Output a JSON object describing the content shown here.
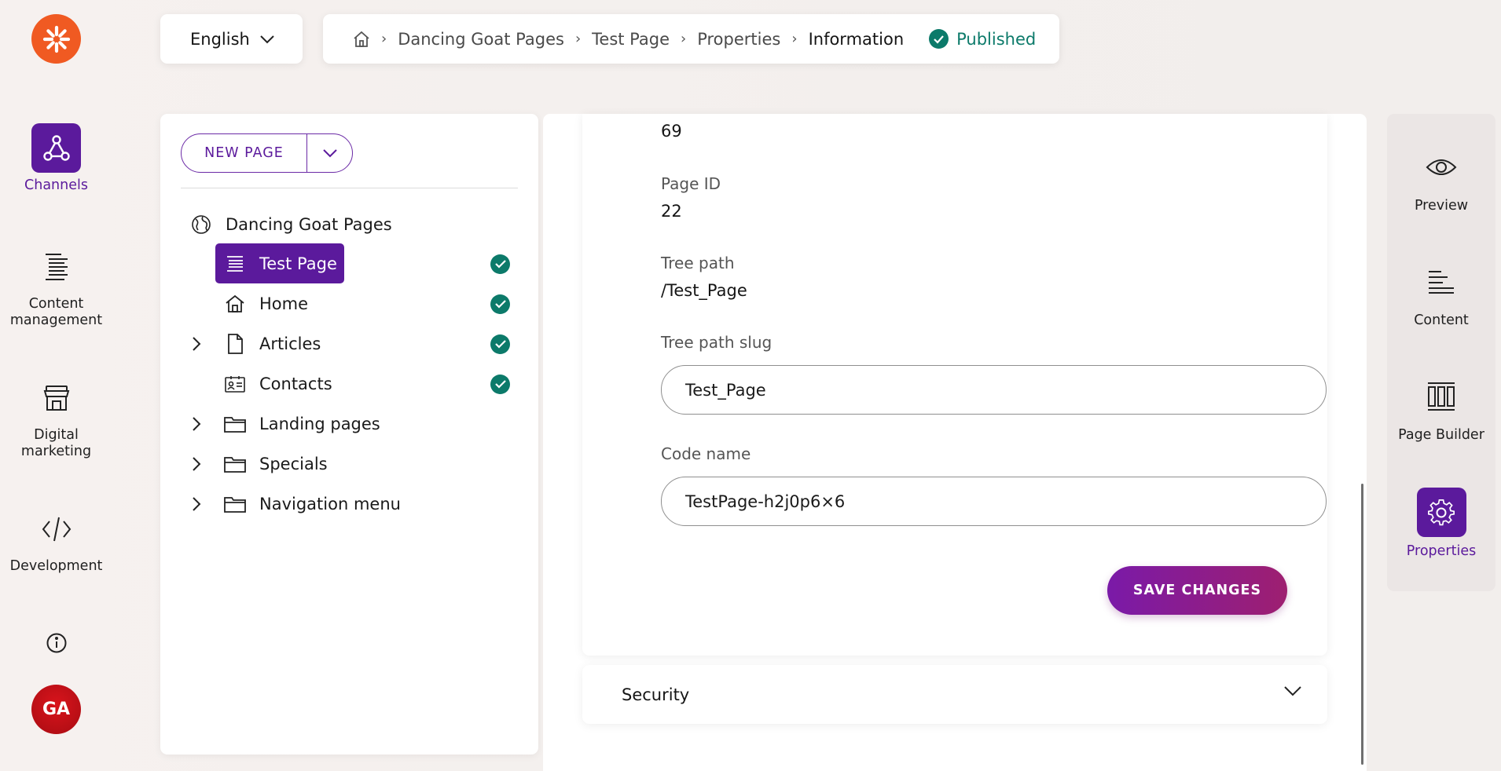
{
  "colors": {
    "brand_purple": "#5b1a9c",
    "logo_orange": "#f05a22",
    "status_green": "#0c7a6a",
    "avatar_red": "#c8101a"
  },
  "left_nav": {
    "items": [
      {
        "label": "Channels",
        "icon": "channels-icon",
        "active": true
      },
      {
        "label": "Content management",
        "icon": "content-management-icon",
        "active": false
      },
      {
        "label": "Digital marketing",
        "icon": "digital-marketing-icon",
        "active": false
      },
      {
        "label": "Development",
        "icon": "development-icon",
        "active": false
      }
    ],
    "avatar_initials": "GA"
  },
  "topbar": {
    "language": "English",
    "breadcrumb": [
      "Dancing Goat Pages",
      "Test Page",
      "Properties",
      "Information"
    ],
    "status": "Published"
  },
  "tree": {
    "new_page_label": "NEW PAGE",
    "root": "Dancing Goat Pages",
    "items": [
      {
        "label": "Test Page",
        "icon": "page-lines-icon",
        "selected": true,
        "published": true,
        "expandable": false
      },
      {
        "label": "Home",
        "icon": "home-icon",
        "selected": false,
        "published": true,
        "expandable": false
      },
      {
        "label": "Articles",
        "icon": "file-icon",
        "selected": false,
        "published": true,
        "expandable": true
      },
      {
        "label": "Contacts",
        "icon": "contact-card-icon",
        "selected": false,
        "published": true,
        "expandable": false
      },
      {
        "label": "Landing pages",
        "icon": "folder-icon",
        "selected": false,
        "published": false,
        "expandable": true
      },
      {
        "label": "Specials",
        "icon": "folder-icon",
        "selected": false,
        "published": false,
        "expandable": true
      },
      {
        "label": "Navigation menu",
        "icon": "folder-icon",
        "selected": false,
        "published": false,
        "expandable": true
      }
    ]
  },
  "main": {
    "top_value": "69",
    "page_id_label": "Page ID",
    "page_id_value": "22",
    "tree_path_label": "Tree path",
    "tree_path_value": "/Test_Page",
    "tree_path_slug_label": "Tree path slug",
    "tree_path_slug_value": "Test_Page",
    "code_name_label": "Code name",
    "code_name_value": "TestPage-h2j0p6×6",
    "save_label": "SAVE CHANGES",
    "security_label": "Security"
  },
  "right_rail": {
    "items": [
      {
        "label": "Preview",
        "icon": "eye-icon",
        "active": false
      },
      {
        "label": "Content",
        "icon": "content-lines-icon",
        "active": false
      },
      {
        "label": "Page Builder",
        "icon": "page-builder-icon",
        "active": false
      },
      {
        "label": "Properties",
        "icon": "gear-icon",
        "active": true
      }
    ]
  }
}
